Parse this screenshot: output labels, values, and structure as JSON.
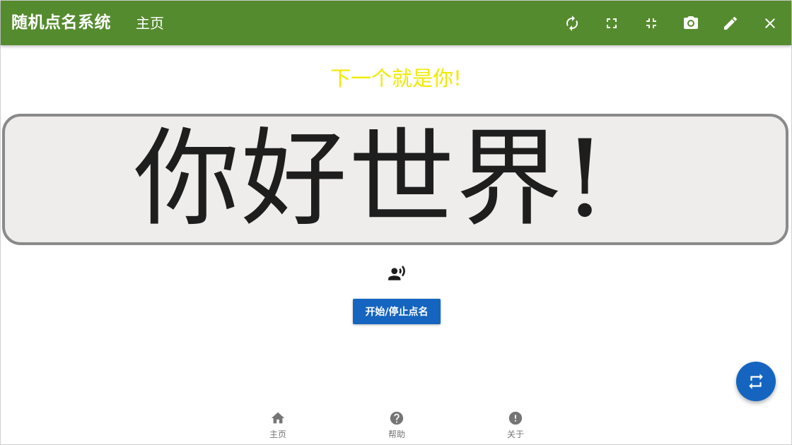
{
  "app": {
    "title": "随机点名系统",
    "page_title": "主页"
  },
  "toolbar": {
    "refresh_icon": "refresh-icon",
    "fullscreen_icon": "fullscreen-icon",
    "exit_fullscreen_icon": "fullscreen-exit-icon",
    "camera_icon": "camera-icon",
    "edit_icon": "pencil-icon",
    "close_icon": "close-icon"
  },
  "main": {
    "next_text": "下一个就是你!",
    "name_display": "你好世界!",
    "voice_icon": "record-voice-icon",
    "start_button_label": "开始/停止点名"
  },
  "fab": {
    "icon": "swap-horizontal-icon"
  },
  "bottom_nav": {
    "items": [
      {
        "label": "主页",
        "icon": "home-icon"
      },
      {
        "label": "帮助",
        "icon": "help-circle-icon"
      },
      {
        "label": "关于",
        "icon": "info-circle-icon"
      }
    ]
  },
  "colors": {
    "appbar": "#558b2f",
    "accent": "#1565c0",
    "next_text": "#f0ea00",
    "display_bg": "#eeedeb",
    "display_border": "#8a8a8a",
    "nav_icon": "#757575"
  }
}
